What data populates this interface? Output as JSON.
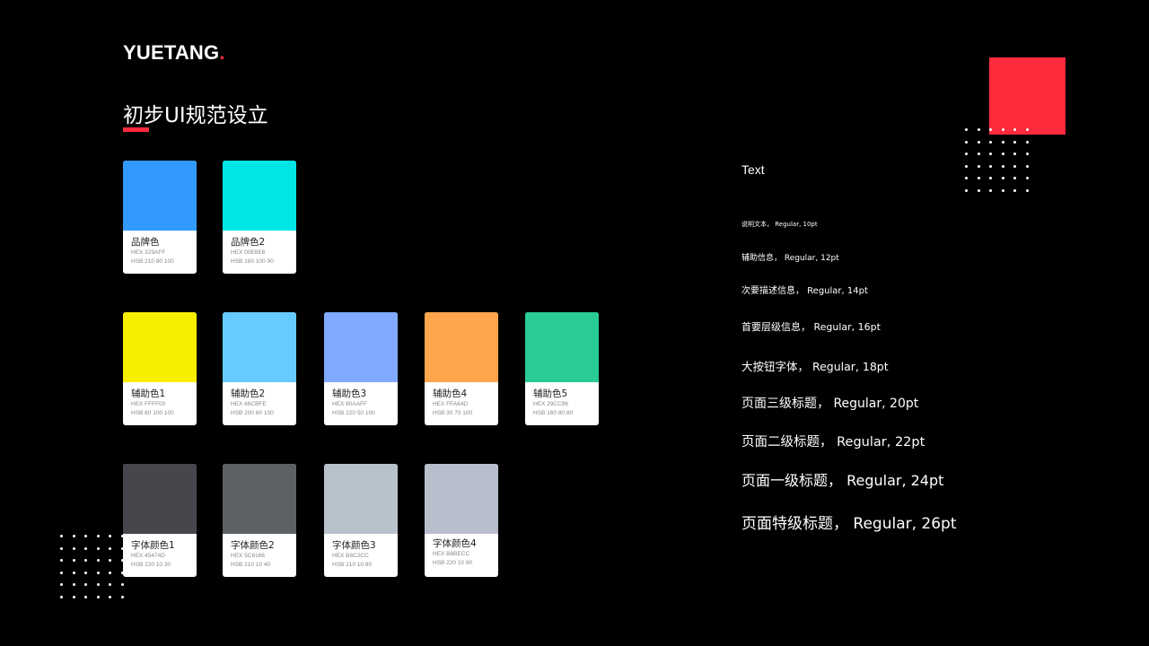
{
  "brand": {
    "name": "YUETANG",
    "dot": ".",
    "accent": "#ff2a3c"
  },
  "page": {
    "title": "初步UI规范设立"
  },
  "swatches": [
    {
      "name": "品牌色",
      "hex": "HEX  329AFF",
      "hsb": "HSB  210 80 100",
      "color": "#329AFF"
    },
    {
      "name": "品牌色2",
      "hex": "HEX  00E6E6",
      "hsb": "HSB  180 100 90",
      "color": "#00E6E6"
    },
    {
      "name": "辅助色1",
      "hex": "HEX  FFFF00",
      "hsb": "HSB  60 100 100",
      "color": "#F8EE00"
    },
    {
      "name": "辅助色2",
      "hex": "HEX  66CBFE",
      "hsb": "HSB  200 60 100",
      "color": "#66CBFE"
    },
    {
      "name": "辅助色3",
      "hex": "HEX  80AAFF",
      "hsb": "HSB  220 50 100",
      "color": "#80AAFF"
    },
    {
      "name": "辅助色4",
      "hex": "HEX  FFA64D",
      "hsb": "HSB  30 70 100",
      "color": "#FFA64D"
    },
    {
      "name": "辅助色5",
      "hex": "HEX  29CC96",
      "hsb": "HSB  160 80 80",
      "color": "#29CC96"
    },
    {
      "name": "字体颜色1",
      "hex": "HEX  45474D",
      "hsb": "HSB  220 10 30",
      "color": "#45474D"
    },
    {
      "name": "字体颜色2",
      "hex": "HEX  5C6166",
      "hsb": "HSB  210 10 40",
      "color": "#5C6166"
    },
    {
      "name": "字体颜色3",
      "hex": "HEX  B8C2CC",
      "hsb": "HSB  210 10 80",
      "color": "#B8C2CC"
    },
    {
      "name": "字体颜色4",
      "hex": "HEX  B8BECC",
      "hsb": "HSB  220 10 80",
      "color": "#B8BECC"
    }
  ],
  "typography": {
    "label": "Text",
    "rows": [
      {
        "label": "说明文本， Regular, 10pt"
      },
      {
        "label": "辅助信息， Regular, 12pt"
      },
      {
        "label": "次要描述信息， Regular, 14pt"
      },
      {
        "label": "首要层级信息， Regular, 16pt"
      },
      {
        "label": "大按钮字体， Regular, 18pt"
      },
      {
        "label": "页面三级标题， Regular, 20pt"
      },
      {
        "label": "页面二级标题， Regular, 22pt"
      },
      {
        "label": "页面一级标题， Regular, 24pt"
      },
      {
        "label": "页面特级标题， Regular, 26pt"
      }
    ]
  }
}
